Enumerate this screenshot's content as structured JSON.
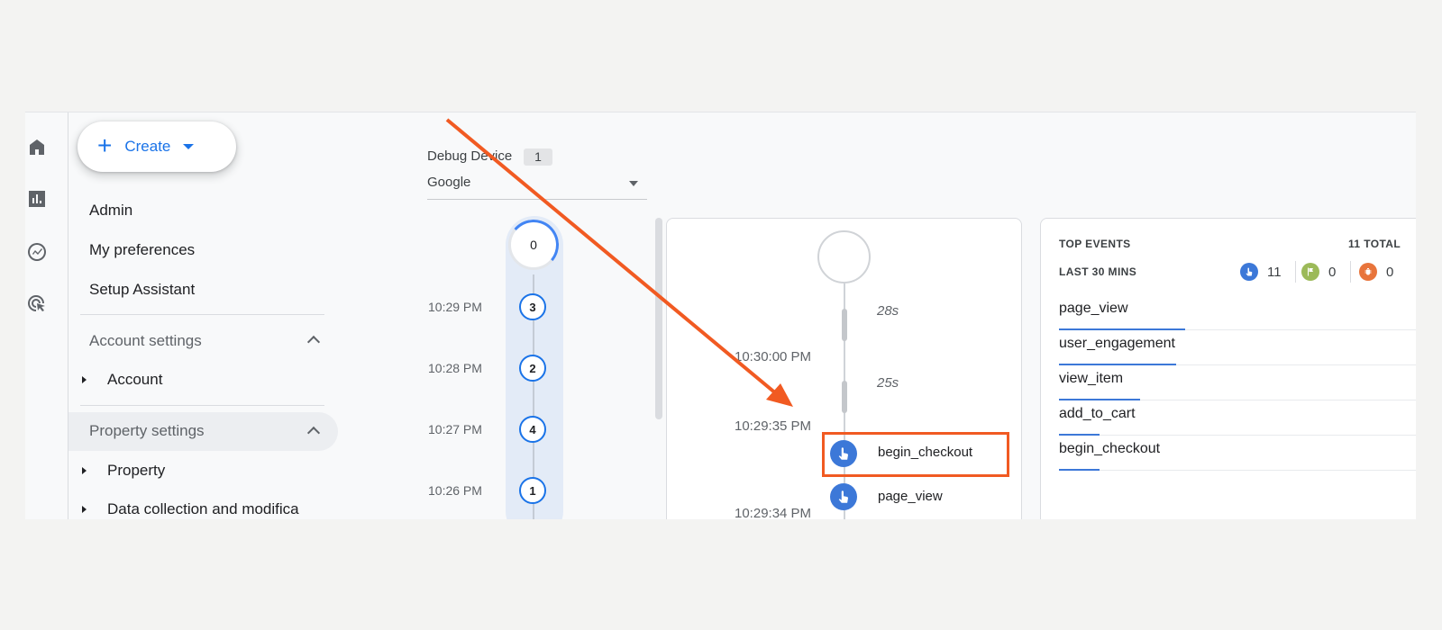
{
  "rail_icons": [
    "home-icon",
    "reports-icon",
    "explore-icon",
    "advertising-icon"
  ],
  "nav": {
    "create_label": "Create",
    "admin": "Admin",
    "my_preferences": "My preferences",
    "setup_assistant": "Setup Assistant",
    "account_settings": "Account settings",
    "account": "Account",
    "property_settings": "Property settings",
    "property": "Property",
    "data_collection": "Data collection and modifica"
  },
  "debug_device": {
    "label": "Debug Device",
    "count": "1",
    "value": "Google"
  },
  "minutes": {
    "top_count": "0",
    "items": [
      {
        "time": "10:29 PM",
        "count": "3"
      },
      {
        "time": "10:28 PM",
        "count": "2"
      },
      {
        "time": "10:27 PM",
        "count": "4"
      },
      {
        "time": "10:26 PM",
        "count": "1"
      }
    ]
  },
  "seconds": {
    "gaps": [
      "28s",
      "25s"
    ],
    "times": [
      "10:30:00 PM",
      "10:29:35 PM",
      "10:29:34 PM"
    ],
    "events": [
      "begin_checkout",
      "page_view"
    ]
  },
  "top_events": {
    "title": "TOP EVENTS",
    "subtitle": "LAST 30 MINS",
    "total": "11 TOTAL",
    "counts": [
      {
        "icon": "event-icon",
        "value": "11",
        "color": "#3c78d8"
      },
      {
        "icon": "conversion-flag-icon",
        "value": "0",
        "color": "#9cba59"
      },
      {
        "icon": "error-bug-icon",
        "value": "0",
        "color": "#e8743b"
      }
    ],
    "rows": [
      {
        "name": "page_view",
        "share": 0.28
      },
      {
        "name": "user_engagement",
        "share": 0.26
      },
      {
        "name": "view_item",
        "share": 0.18
      },
      {
        "name": "add_to_cart",
        "share": 0.09
      },
      {
        "name": "begin_checkout",
        "share": 0.09
      }
    ]
  },
  "colors": {
    "accent": "#1a73e8",
    "event_blue": "#3c78d8",
    "annotation": "#f15a22"
  }
}
